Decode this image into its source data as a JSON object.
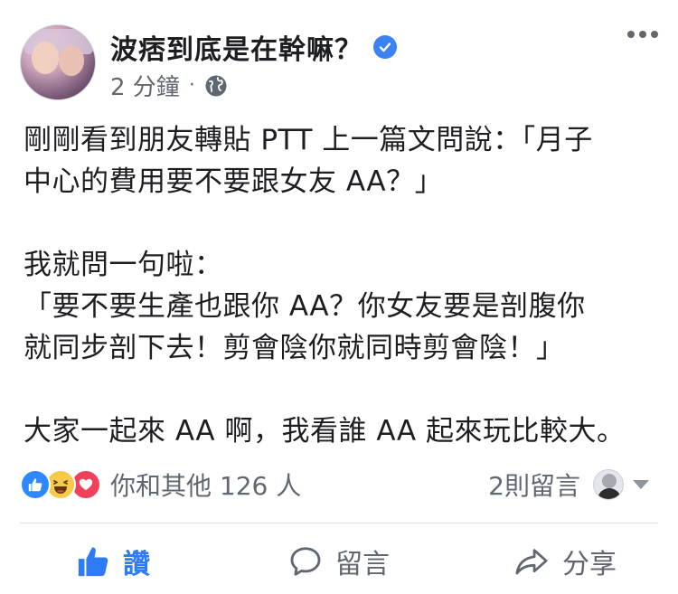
{
  "post": {
    "author": "波痞到底是在幹嘛？",
    "time": "2 分鐘",
    "separator": "·",
    "paragraphs": [
      "剛剛看到朋友轉貼 PTT 上一篇文問說：「月子\n中心的費用要不要跟女友 AA？」",
      "我就問一句啦：\n「要不要生產也跟你 AA？你女友要是剖腹你\n就同步剖下去！剪會陰你就同時剪會陰！」",
      "大家一起來 AA 啊，我看誰 AA 起來玩比較大。"
    ]
  },
  "reactions": {
    "types": [
      "like",
      "haha",
      "love"
    ],
    "summary": "你和其他 126 人",
    "comments": "2則留言"
  },
  "actions": {
    "like": "讚",
    "comment": "留言",
    "share": "分享"
  },
  "colors": {
    "accent": "#2e7bf6",
    "verified": "#3b82f6",
    "muted": "#606770"
  }
}
